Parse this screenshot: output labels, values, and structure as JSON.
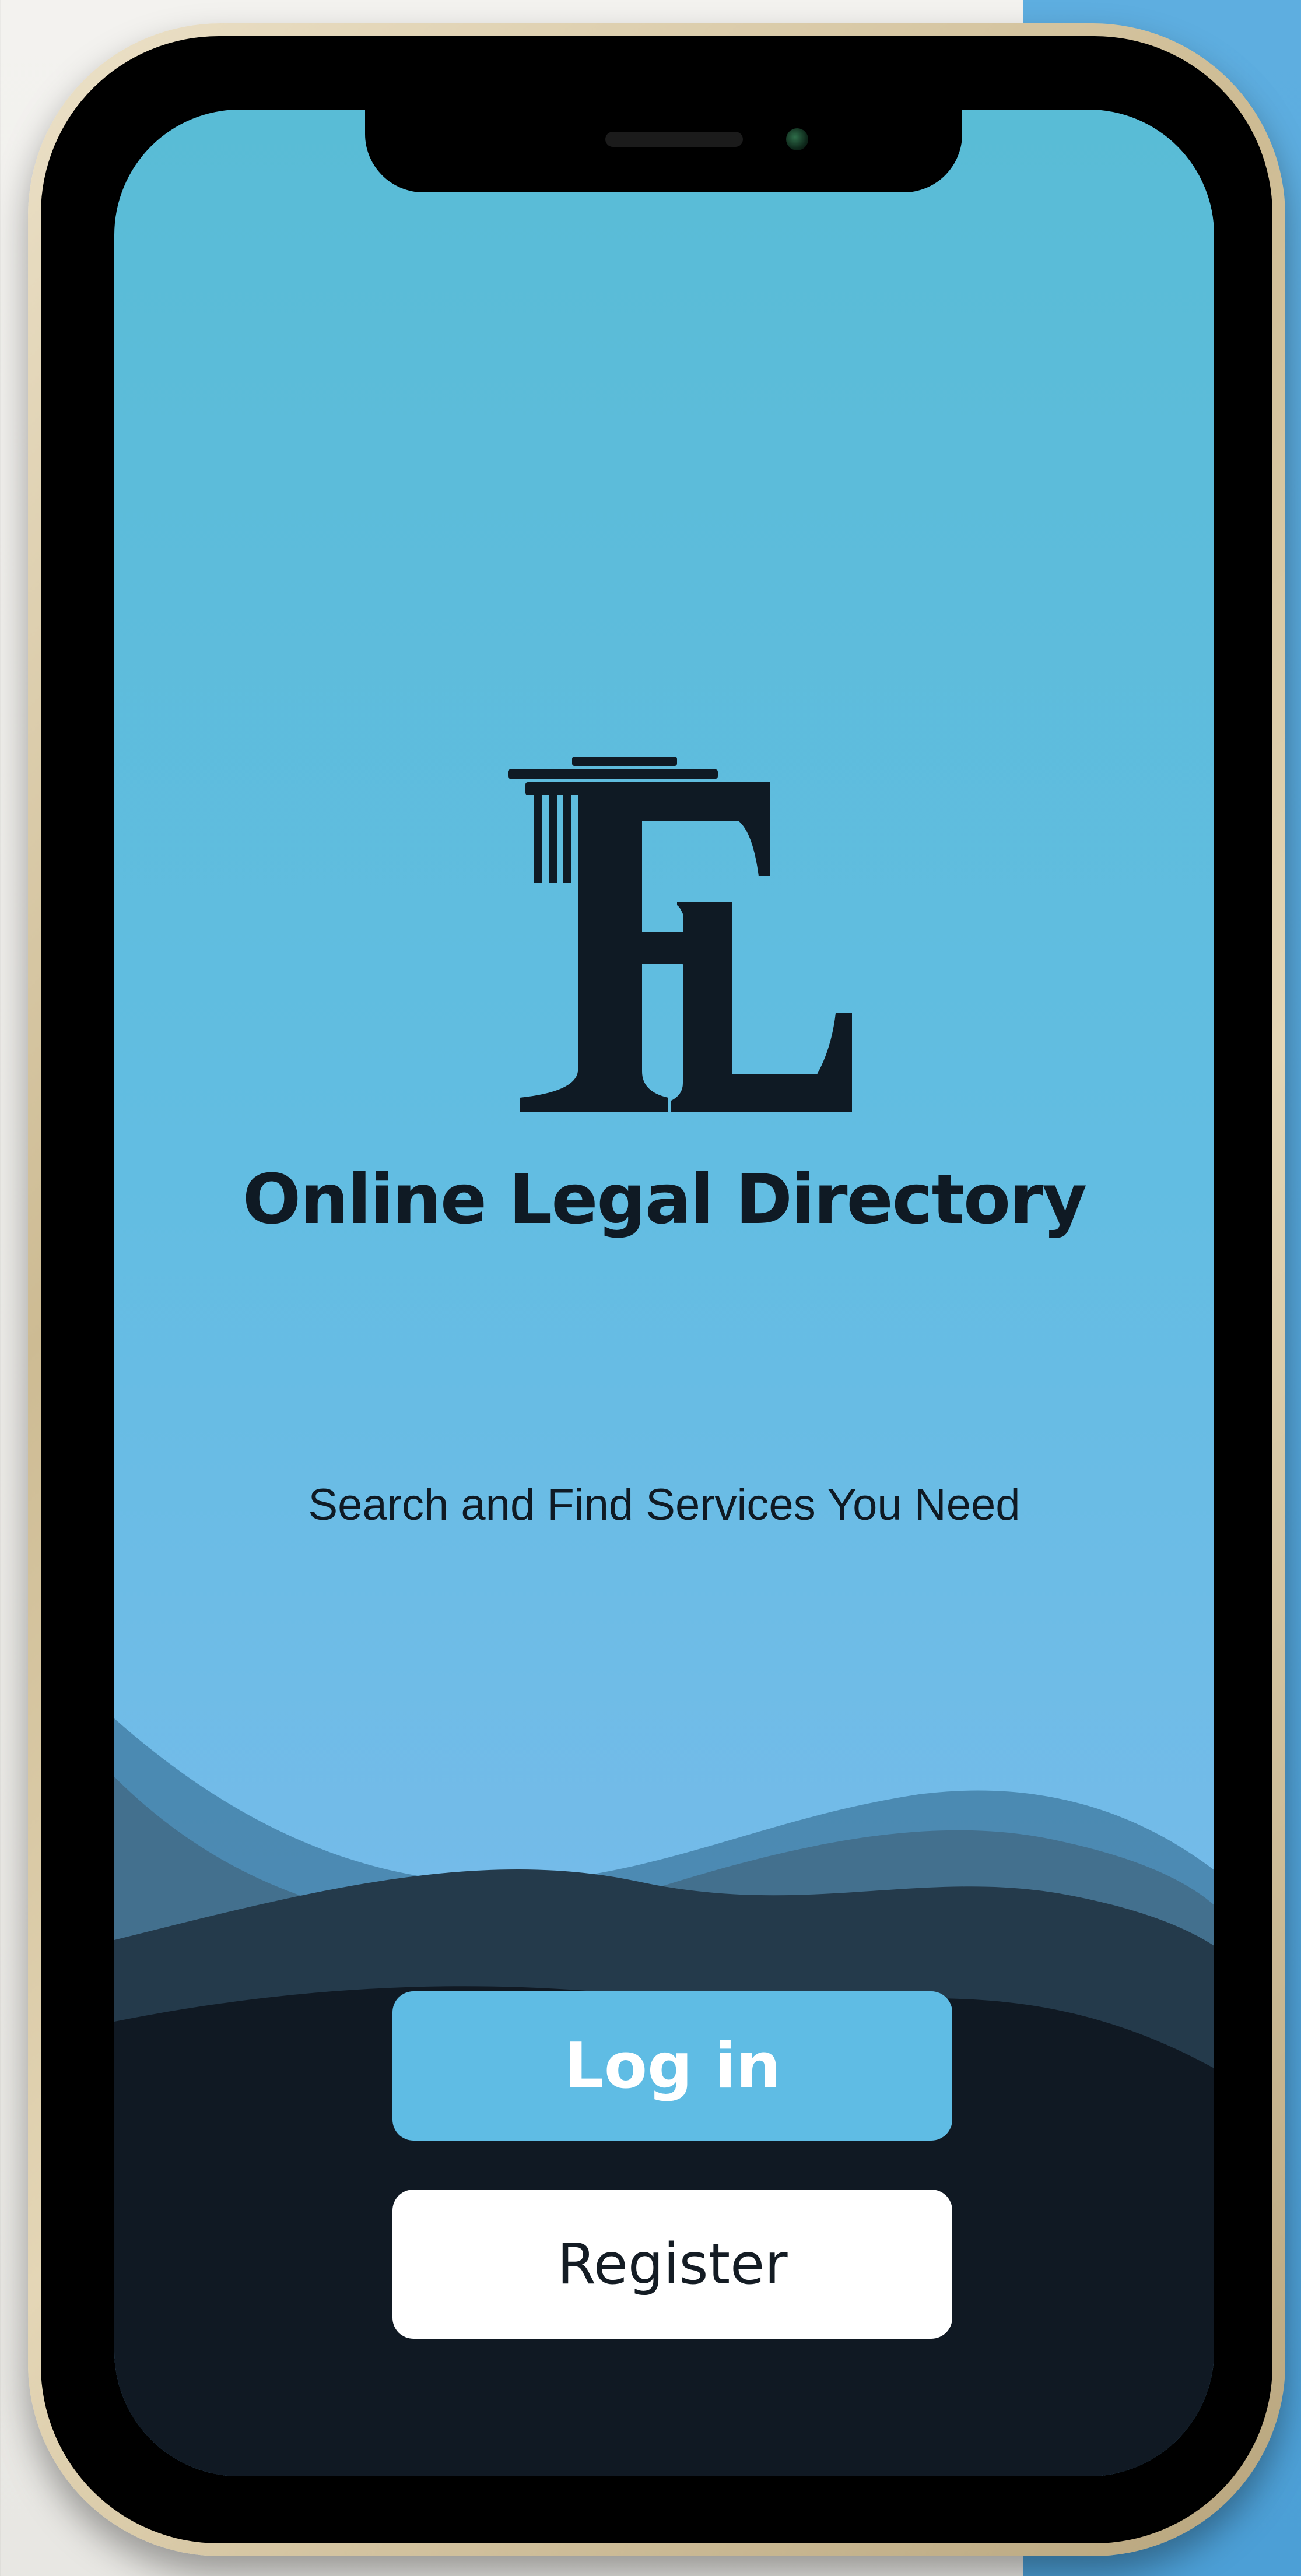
{
  "app": {
    "logo_monogram": "FL",
    "title": "Online Legal Directory",
    "tagline": "Search and Find Services You Need"
  },
  "actions": {
    "login_label": "Log in",
    "register_label": "Register"
  },
  "theme": {
    "sky_top": "#59bcd6",
    "sky_bottom": "#7cbcec",
    "navy": "#101923",
    "accent_blue": "#5fbce4",
    "frame_gold": "#cdbb93"
  }
}
